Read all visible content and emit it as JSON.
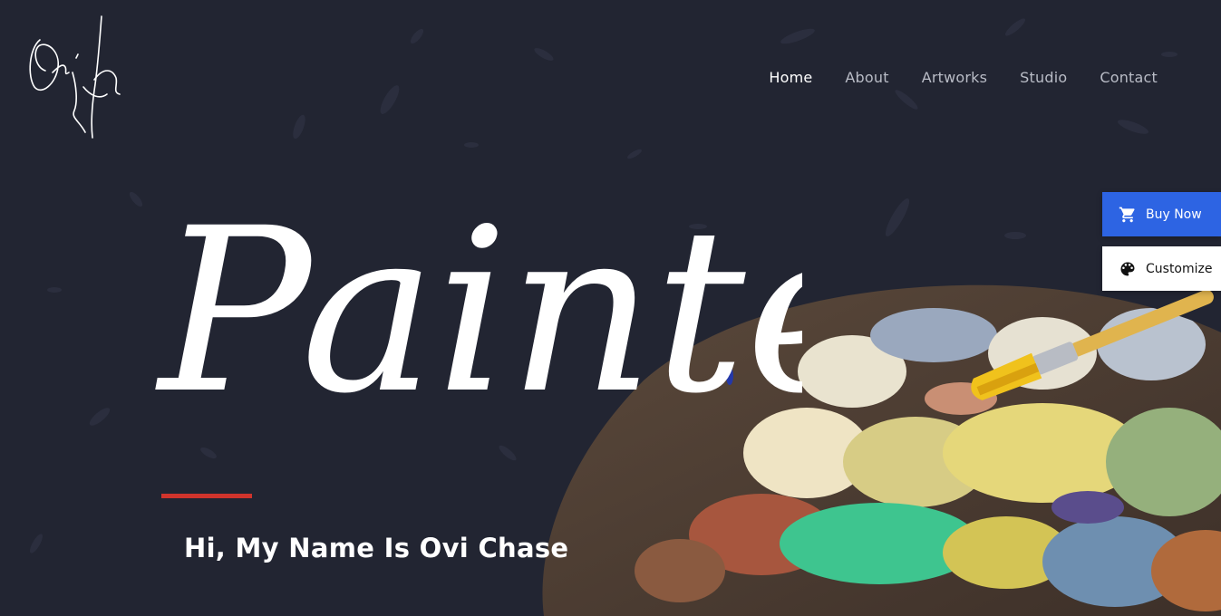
{
  "nav": {
    "items": [
      {
        "label": "Home",
        "active": true
      },
      {
        "label": "About",
        "active": false
      },
      {
        "label": "Artworks",
        "active": false
      },
      {
        "label": "Studio",
        "active": false
      },
      {
        "label": "Contact",
        "active": false
      }
    ]
  },
  "hero": {
    "title": "Painter",
    "greeting": "Hi, My Name Is Ovi Chase",
    "accent_line_color": "#d0342c"
  },
  "side_actions": {
    "buy_label": "Buy Now",
    "buy_icon": "cart-icon",
    "buy_color": "#2d64e3",
    "customize_label": "Customize",
    "customize_icon": "palette-icon"
  },
  "logo": {
    "type": "signature-logo",
    "text": "Ovi Chase"
  },
  "colors": {
    "background": "#222532",
    "text": "#ffffff",
    "nav_muted": "#b9bcc6"
  }
}
